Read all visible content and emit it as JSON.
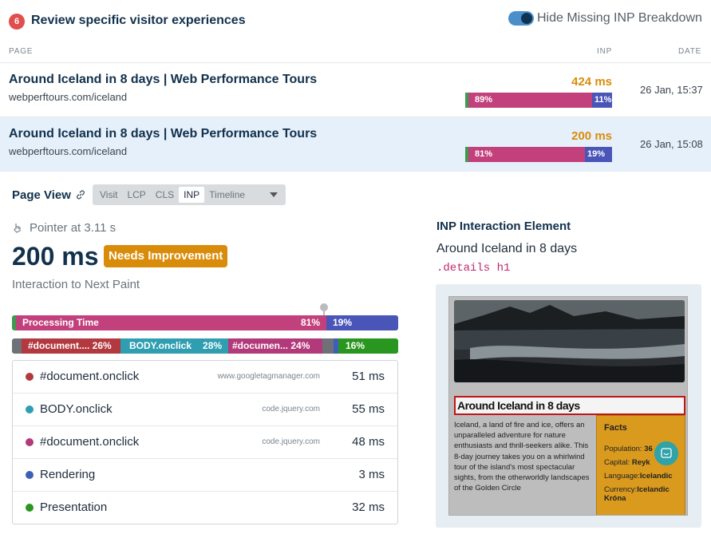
{
  "header": {
    "count_badge": "6",
    "title": "Review specific visitor experiences",
    "toggle_label": "Hide Missing INP Breakdown"
  },
  "table": {
    "columns": {
      "page": "PAGE",
      "inp": "INP",
      "date": "DATE"
    },
    "rows": [
      {
        "title": "Around Iceland in 8 days | Web Performance Tours",
        "url": "webperftours.com/iceland",
        "inp": "424 ms",
        "processing_pct": "89%",
        "rendering_pct": "11%",
        "processing_fraction": 0.89,
        "date": "26 Jan, 15:37",
        "selected": false
      },
      {
        "title": "Around Iceland in 8 days | Web Performance Tours",
        "url": "webperftours.com/iceland",
        "inp": "200 ms",
        "processing_pct": "81%",
        "rendering_pct": "19%",
        "processing_fraction": 0.81,
        "date": "26 Jan, 15:08",
        "selected": true
      }
    ]
  },
  "page_view": {
    "title": "Page View",
    "tabs": [
      "Visit",
      "LCP",
      "CLS",
      "INP",
      "Timeline"
    ],
    "active_tab": "INP"
  },
  "interaction": {
    "trigger": "Pointer at 3.11 s",
    "value": "200 ms",
    "status": "Needs Improvement",
    "metric": "Interaction to Next Paint"
  },
  "breakdown": {
    "processing_label": "Processing Time",
    "processing_pct": "81%",
    "rendering_pct": "19%",
    "scripts": [
      {
        "label": "#document.... 26%"
      },
      {
        "label": "BODY.onclick",
        "pct": "28%"
      },
      {
        "label": "#documen... 24%"
      },
      {
        "label": "16%"
      }
    ],
    "items": [
      {
        "label": "#document.onclick",
        "source": "www.googletagmanager.com",
        "value": "51 ms",
        "color": "#b2393f"
      },
      {
        "label": "BODY.onclick",
        "source": "code.jquery.com",
        "value": "55 ms",
        "color": "#2f9eb0"
      },
      {
        "label": "#document.onclick",
        "source": "code.jquery.com",
        "value": "48 ms",
        "color": "#b2397a"
      },
      {
        "label": "Rendering",
        "source": "",
        "value": "3 ms",
        "color": "#3e5fb8"
      },
      {
        "label": "Presentation",
        "source": "",
        "value": "32 ms",
        "color": "#28961f"
      }
    ]
  },
  "element": {
    "title": "INP Interaction Element",
    "text": "Around Iceland in 8 days",
    "selector": ".details h1"
  },
  "preview": {
    "heading": "Around Iceland in 8 days",
    "body": "Iceland, a land of fire and ice, offers an unparalleled adventure for nature enthusiasts and thrill-seekers alike. This 8-day journey takes you on a whirlwind tour of the island's most spectacular sights, from the otherworldly landscapes of the Golden Circle",
    "facts_title": "Facts",
    "facts": [
      {
        "k": "Population:",
        "v": "36"
      },
      {
        "k": "Capital:",
        "v": "Reyk"
      },
      {
        "k": "Language:",
        "v": "Icelandic"
      },
      {
        "k": "Currency:",
        "v": "Icelandic Króna"
      }
    ]
  }
}
